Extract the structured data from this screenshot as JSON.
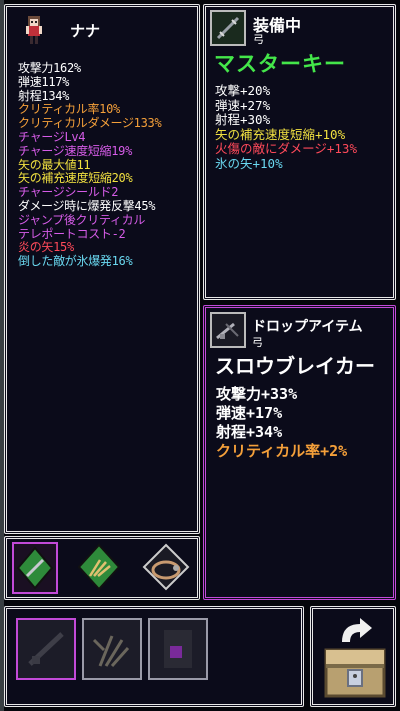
{
  "character": {
    "name": "ナナ",
    "stats": [
      {
        "text": "攻撃力162%",
        "color": "#ffffff"
      },
      {
        "text": "弾速117%",
        "color": "#ffffff"
      },
      {
        "text": "射程134%",
        "color": "#ffffff"
      },
      {
        "text": "クリティカル率10%",
        "color": "#f5a03a"
      },
      {
        "text": "クリティカルダメージ133%",
        "color": "#f5a03a"
      },
      {
        "text": "チャージLv4",
        "color": "#d65ce8"
      },
      {
        "text": "チャージ速度短縮19%",
        "color": "#d65ce8"
      },
      {
        "text": "矢の最大値11",
        "color": "#f0e040"
      },
      {
        "text": "矢の補充速度短縮20%",
        "color": "#f0e040"
      },
      {
        "text": "チャージシールド2",
        "color": "#d65ce8"
      },
      {
        "text": "ダメージ時に爆発反撃45%",
        "color": "#ffffff"
      },
      {
        "text": "ジャンプ後クリティカル",
        "color": "#d65ce8"
      },
      {
        "text": "テレポートコスト-2",
        "color": "#d65ce8"
      },
      {
        "text": "炎の矢15%",
        "color": "#ff4a5a"
      },
      {
        "text": "倒した敵が氷爆発16%",
        "color": "#6ad8f0"
      }
    ]
  },
  "equipped": {
    "title": "装備中",
    "type": "弓",
    "name": "マスターキー",
    "name_color": "#44e64a",
    "stats": [
      {
        "text": "攻撃+20%",
        "color": "#ffffff"
      },
      {
        "text": "弾速+27%",
        "color": "#ffffff"
      },
      {
        "text": "射程+30%",
        "color": "#ffffff"
      },
      {
        "text": "矢の補充速度短縮+10%",
        "color": "#f0e040"
      },
      {
        "text": "火傷の敵にダメージ+13%",
        "color": "#ff4a5a"
      },
      {
        "text": "氷の矢+10%",
        "color": "#6ad8f0"
      }
    ]
  },
  "drop": {
    "title": "ドロップアイテム",
    "type": "弓",
    "name": "スロウブレイカー",
    "stats": [
      {
        "text": "攻撃力+33%",
        "color": "#ffffff"
      },
      {
        "text": "弾速+17%",
        "color": "#ffffff"
      },
      {
        "text": "射程+34%",
        "color": "#ffffff"
      },
      {
        "text": "クリティカル率+2%",
        "color": "#f5a03a"
      }
    ]
  },
  "colors": {
    "panel_border": "#e8e8e8",
    "selected_border": "#c24ad8",
    "slot_green": "#2e8a3a",
    "background": "#0b0b1a"
  },
  "icons": {
    "equipped": "bow-icon",
    "drop": "bow-icon",
    "slot1": "bow-icon",
    "slot2": "claw-icon",
    "slot3": "ring-icon",
    "inv1": "bow-icon",
    "inv2": "claw-icon",
    "inv3": "orb-icon",
    "chest": "chest-icon"
  }
}
